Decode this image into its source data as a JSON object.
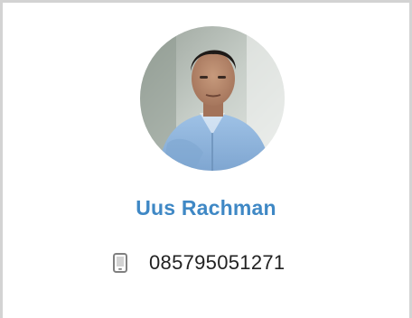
{
  "profile": {
    "name": "Uus Rachman",
    "phone": "085795051271"
  },
  "icons": {
    "avatar": "profile-photo",
    "phone": "mobile-phone-icon"
  },
  "colors": {
    "name": "#3f88c5",
    "border": "#d3d3d3",
    "phone_icon": "#808080",
    "text": "#222222"
  }
}
